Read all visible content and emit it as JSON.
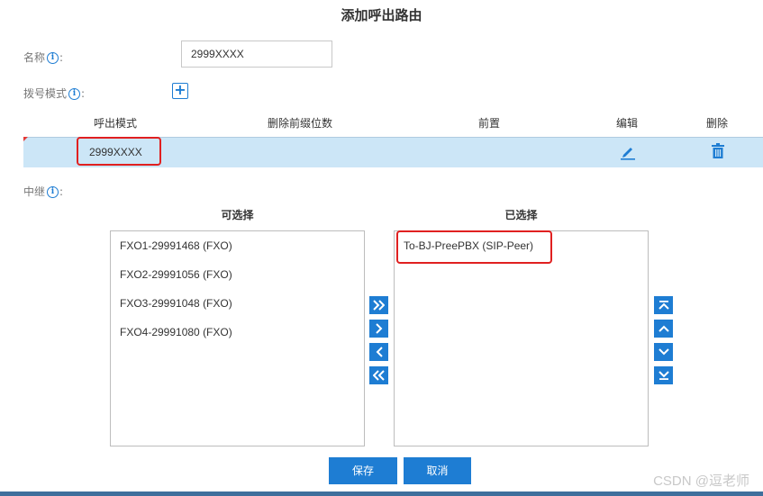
{
  "dialog": {
    "title": "添加呼出路由"
  },
  "form": {
    "name_label": "名称",
    "name_value": "2999XXXX",
    "pattern_label": "拨号模式",
    "trunk_label": "中继",
    "colon": ":",
    "info_glyph": "i",
    "add_glyph": "+"
  },
  "table": {
    "headers": [
      "呼出模式",
      "删除前缀位数",
      "前置",
      "编辑",
      "删除"
    ],
    "rows": [
      {
        "pattern": "2999XXXX",
        "strip": "",
        "prepend": ""
      }
    ]
  },
  "trunks": {
    "available_title": "可选择",
    "selected_title": "已选择",
    "available": [
      "FXO1-29991468 (FXO)",
      "FXO2-29991056 (FXO)",
      "FXO3-29991048 (FXO)",
      "FXO4-29991080 (FXO)"
    ],
    "selected": [
      "To-BJ-PreePBX (SIP-Peer)"
    ]
  },
  "buttons": {
    "save": "保存",
    "cancel": "取消"
  },
  "watermark": "CSDN @逗老师",
  "colors": {
    "accent": "#1e7dd3",
    "row_highlight": "#cce6f7",
    "annotation_red": "#e02020"
  }
}
